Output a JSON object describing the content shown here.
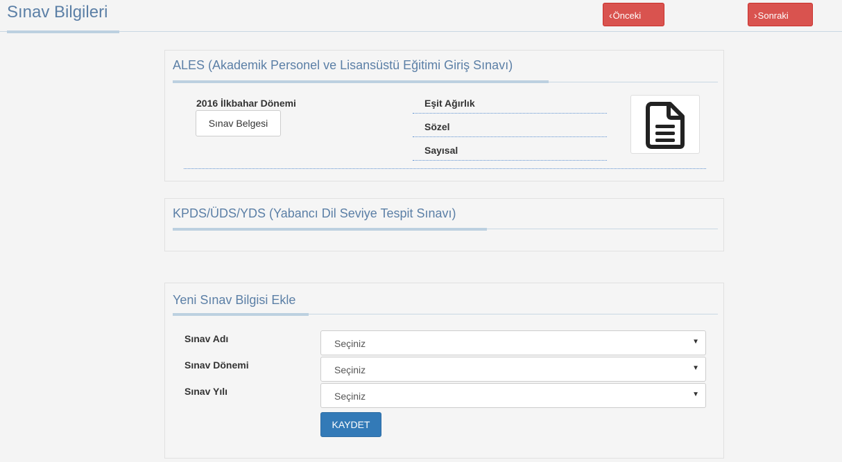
{
  "header": {
    "title": "Sınav Bilgileri",
    "prev_label": "Önceki",
    "next_label": "Sonraki",
    "prev_icon": "‹",
    "next_icon": "›"
  },
  "ales": {
    "title": "ALES (Akademik Personel ve Lisansüstü Eğitimi Giriş Sınavı)",
    "term": "2016 İlkbahar Dönemi",
    "document_button": "Sınav Belgesi",
    "scores": [
      "Eşit Ağırlık",
      "Sözel",
      "Sayısal"
    ],
    "document_icon": "file-text-icon"
  },
  "kpds": {
    "title": "KPDS/ÜDS/YDS (Yabancı Dil Seviye Tespit Sınavı)"
  },
  "new_exam": {
    "title": "Yeni Sınav Bilgisi Ekle",
    "fields": [
      {
        "label": "Sınav Adı",
        "value": "Seçiniz"
      },
      {
        "label": "Sınav Dönemi",
        "value": "Seçiniz"
      },
      {
        "label": "Sınav Yılı",
        "value": "Seçiniz"
      }
    ],
    "save_label": "KAYDET"
  },
  "colors": {
    "accent": "#5b7fa6",
    "danger": "#d9534f",
    "primary": "#337ab7"
  }
}
